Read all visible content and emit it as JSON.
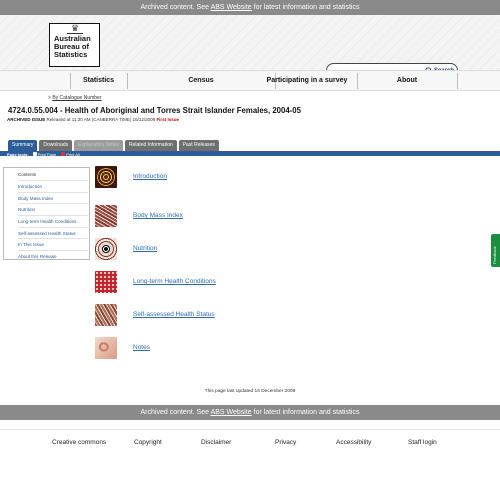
{
  "archive_banner": {
    "prefix": "Archived content. See",
    "link": "ABS Website",
    "suffix": "for latest information and statistics"
  },
  "logo": {
    "text": "Australian\nBureau of\nStatistics"
  },
  "search": {
    "value": "",
    "button_label": "Search"
  },
  "nav": {
    "items": [
      "Statistics",
      "Census",
      "Participating in a survey",
      "About"
    ]
  },
  "breadcrumb": {
    "prefix": ">",
    "link": "By Catalogue Number"
  },
  "page": {
    "title": "4724.0.55.004 - Health of Aboriginal and Torres Strait Islander Females, 2004-05",
    "issue_label": "ARCHIVED ISSUE",
    "released": "Released at 11:30 AM (CANBERRA TIME) 16/12/2009",
    "first_issue": "First Issue"
  },
  "tabs": [
    {
      "label": "Summary",
      "state": "active"
    },
    {
      "label": "Downloads",
      "state": "normal"
    },
    {
      "label": "Explanatory Notes",
      "state": "disabled"
    },
    {
      "label": "Related Information",
      "state": "normal"
    },
    {
      "label": "Past Releases",
      "state": "normal"
    }
  ],
  "page_tools": {
    "label": "Page tools:",
    "print_page": "Print Page",
    "print_all": "Print All"
  },
  "contents": {
    "title": "Contents",
    "items": [
      "Introduction",
      "Body Mass Index",
      "Nutrition",
      "Long-term Health Conditions",
      "Self-assessed Health Status",
      "In This Issue",
      "About this Release"
    ]
  },
  "topics": [
    {
      "label": "Introduction",
      "icon": "introduction-thumbnail"
    },
    {
      "label": "Body Mass Index",
      "icon": "body-mass-index-thumbnail"
    },
    {
      "label": "Nutrition",
      "icon": "nutrition-thumbnail"
    },
    {
      "label": "Long-term Health Conditions",
      "icon": "long-term-health-conditions-thumbnail"
    },
    {
      "label": "Self-assessed Health Status",
      "icon": "self-assessed-health-status-thumbnail"
    },
    {
      "label": "Notes",
      "icon": "notes-thumbnail"
    }
  ],
  "last_updated": "This page last updated 16 December 2009",
  "footer": {
    "links": [
      "Creative commons",
      "Copyright",
      "Disclaimer",
      "Privacy",
      "Accessibility",
      "Staff login"
    ]
  },
  "feedback_tab": "Feedback",
  "colors": {
    "archive_bar": "#8a8a8a",
    "brand_blue": "#2c5d99",
    "link_blue": "#2c6cb0",
    "first_issue_red": "#cc0000",
    "feedback_green": "#1c8e3f"
  }
}
